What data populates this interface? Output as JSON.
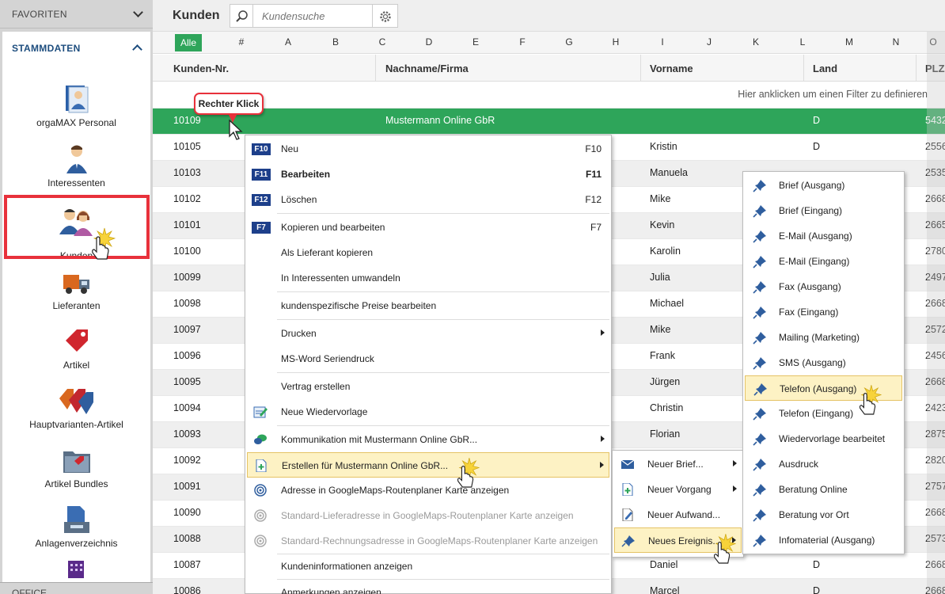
{
  "sidebar": {
    "favorites_label": "FAVORITEN",
    "stammdaten_label": "STAMMDATEN",
    "items": [
      {
        "label": "orgaMAX Personal",
        "icon": "personnel-file-icon"
      },
      {
        "label": "Interessenten",
        "icon": "prospect-person-icon"
      },
      {
        "label": "Kunden",
        "icon": "customers-icon"
      },
      {
        "label": "Lieferanten",
        "icon": "delivery-truck-icon"
      },
      {
        "label": "Artikel",
        "icon": "price-tag-icon"
      },
      {
        "label": "Hauptvarianten-Artikel",
        "icon": "multi-tag-icon"
      },
      {
        "label": "Artikel Bundles",
        "icon": "bundle-folder-icon"
      },
      {
        "label": "Anlagenverzeichnis",
        "icon": "asset-register-icon"
      }
    ],
    "office_label": "OFFICE",
    "accent": "#1d4d7e",
    "highlight_color": "#e8313b"
  },
  "header": {
    "title": "Kunden",
    "search_placeholder": "Kundensuche"
  },
  "alphabet": {
    "all_label": "Alle",
    "letters": [
      "#",
      "A",
      "B",
      "C",
      "D",
      "E",
      "F",
      "G",
      "H",
      "I",
      "J",
      "K",
      "L",
      "M",
      "N",
      "O"
    ]
  },
  "table": {
    "columns": [
      "Kunden-Nr.",
      "Nachname/Firma",
      "Vorname",
      "Land",
      "PLZ"
    ],
    "filter_hint": "Hier anklicken um einen Filter zu definieren",
    "rows": [
      {
        "nr": "10109",
        "name": "Mustermann Online GbR",
        "vorname": "",
        "land": "D",
        "plz": "5432"
      },
      {
        "nr": "10105",
        "name": "",
        "vorname": "Kristin",
        "land": "D",
        "plz": "2556"
      },
      {
        "nr": "10103",
        "name": "",
        "vorname": "Manuela",
        "land": "",
        "plz": "2535"
      },
      {
        "nr": "10102",
        "name": "",
        "vorname": "Mike",
        "land": "",
        "plz": "2668"
      },
      {
        "nr": "10101",
        "name": "",
        "vorname": "Kevin",
        "land": "",
        "plz": "2665"
      },
      {
        "nr": "10100",
        "name": "",
        "vorname": "Karolin",
        "land": "",
        "plz": "2780"
      },
      {
        "nr": "10099",
        "name": "",
        "vorname": "Julia",
        "land": "",
        "plz": "2497"
      },
      {
        "nr": "10098",
        "name": "",
        "vorname": "Michael",
        "land": "",
        "plz": "2668"
      },
      {
        "nr": "10097",
        "name": "",
        "vorname": "Mike",
        "land": "",
        "plz": "2572"
      },
      {
        "nr": "10096",
        "name": "",
        "vorname": "Frank",
        "land": "",
        "plz": "2456"
      },
      {
        "nr": "10095",
        "name": "",
        "vorname": "Jürgen",
        "land": "",
        "plz": "2668"
      },
      {
        "nr": "10094",
        "name": "",
        "vorname": "Christin",
        "land": "",
        "plz": "2423"
      },
      {
        "nr": "10093",
        "name": "",
        "vorname": "Florian",
        "land": "",
        "plz": "2875"
      },
      {
        "nr": "10092",
        "name": "",
        "vorname": "",
        "land": "",
        "plz": "2820"
      },
      {
        "nr": "10091",
        "name": "",
        "vorname": "",
        "land": "",
        "plz": "2757"
      },
      {
        "nr": "10090",
        "name": "",
        "vorname": "",
        "land": "",
        "plz": "2668"
      },
      {
        "nr": "10088",
        "name": "",
        "vorname": "",
        "land": "",
        "plz": "2573"
      },
      {
        "nr": "10087",
        "name": "",
        "vorname": "Daniel",
        "land": "D",
        "plz": "2668"
      },
      {
        "nr": "10086",
        "name": "",
        "vorname": "Marcel",
        "land": "D",
        "plz": "2668"
      }
    ],
    "selected_color": "#2ea55a"
  },
  "callout": {
    "text": "Rechter Klick"
  },
  "context_menu": {
    "items": [
      {
        "fkey": "F10",
        "label": "Neu",
        "shortcut": "F10"
      },
      {
        "fkey": "F11",
        "label": "Bearbeiten",
        "shortcut": "F11"
      },
      {
        "fkey": "F12",
        "label": "Löschen",
        "shortcut": "F12"
      },
      {
        "fkey": "F7",
        "label": "Kopieren und bearbeiten",
        "shortcut": "F7"
      },
      {
        "label": "Als Lieferant kopieren"
      },
      {
        "label": "In Interessenten umwandeln"
      },
      {
        "label": "kundenspezifische Preise bearbeiten"
      },
      {
        "label": "Drucken"
      },
      {
        "label": "MS-Word Seriendruck"
      },
      {
        "label": "Vertrag erstellen"
      },
      {
        "label": "Neue Wiedervorlage"
      },
      {
        "label": "Kommunikation mit Mustermann Online GbR..."
      },
      {
        "label": "Erstellen für Mustermann Online GbR..."
      },
      {
        "label": "Adresse in GoogleMaps-Routenplaner Karte anzeigen"
      },
      {
        "label": "Standard-Lieferadresse in GoogleMaps-Routenplaner Karte anzeigen"
      },
      {
        "label": "Standard-Rechnungsadresse in GoogleMaps-Routenplaner Karte anzeigen"
      },
      {
        "label": "Kundeninformationen anzeigen"
      },
      {
        "label": "Anmerkungen anzeigen"
      }
    ]
  },
  "submenu_create": {
    "items": [
      {
        "label": "Neuer Brief..."
      },
      {
        "label": "Neuer Vorgang"
      },
      {
        "label": "Neuer Aufwand..."
      },
      {
        "label": "Neues Ereignis..."
      }
    ]
  },
  "submenu_event": {
    "items": [
      {
        "label": "Brief (Ausgang)"
      },
      {
        "label": "Brief (Eingang)"
      },
      {
        "label": "E-Mail (Ausgang)"
      },
      {
        "label": "E-Mail (Eingang)"
      },
      {
        "label": "Fax (Ausgang)"
      },
      {
        "label": "Fax (Eingang)"
      },
      {
        "label": "Mailing (Marketing)"
      },
      {
        "label": "SMS (Ausgang)"
      },
      {
        "label": "Telefon (Ausgang)"
      },
      {
        "label": "Telefon (Eingang)"
      },
      {
        "label": "Wiedervorlage bearbeitet"
      },
      {
        "label": "Ausdruck"
      },
      {
        "label": "Beratung Online"
      },
      {
        "label": "Beratung vor Ort"
      },
      {
        "label": "Infomaterial (Ausgang)"
      }
    ]
  },
  "menu_highlight_color": "#fdf2c4"
}
